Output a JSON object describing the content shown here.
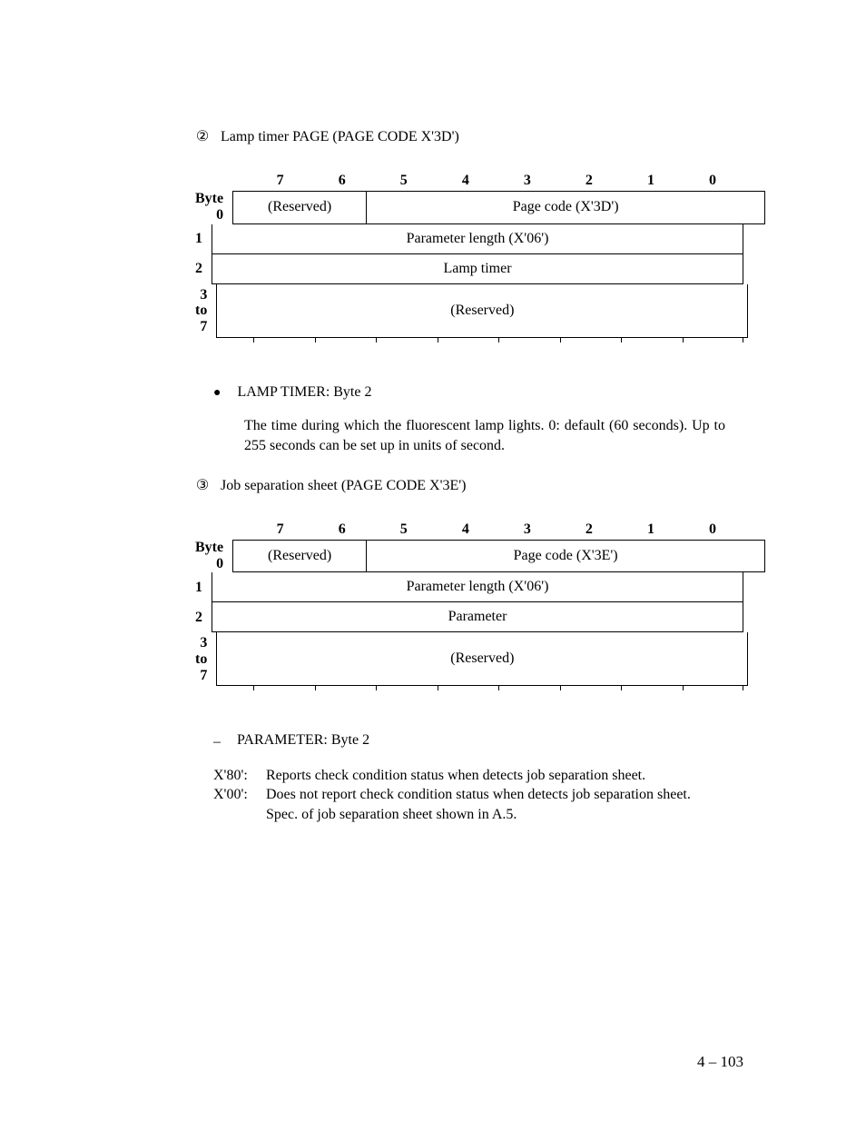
{
  "section1": {
    "num_glyph": "②",
    "title": "Lamp timer PAGE (PAGE CODE X'3D')"
  },
  "bits": [
    "7",
    "6",
    "5",
    "4",
    "3",
    "2",
    "1",
    "0"
  ],
  "table1": {
    "rows": [
      {
        "label": "Byte 0",
        "cells": [
          {
            "span": 2,
            "text": "(Reserved)"
          },
          {
            "span": 6,
            "text": "Page code (X'3D')"
          }
        ]
      },
      {
        "label": "1",
        "cells": [
          {
            "span": 8,
            "text": "Parameter length (X'06')"
          }
        ]
      },
      {
        "label": "2",
        "cells": [
          {
            "span": 8,
            "text": "Lamp timer"
          }
        ]
      },
      {
        "label_multi": [
          "3",
          "to",
          "7"
        ],
        "tall": true,
        "cells": [
          {
            "span": 8,
            "text": "(Reserved)"
          }
        ]
      }
    ]
  },
  "bullet1": {
    "mark": "●",
    "heading": "LAMP TIMER:  Byte 2",
    "body": "The time during which the fluorescent lamp lights.  0:  default (60 seconds). Up to 255 seconds can be set up in units of second."
  },
  "section2": {
    "num_glyph": "③",
    "title": "Job separation sheet (PAGE CODE X'3E')"
  },
  "table2": {
    "rows": [
      {
        "label": "Byte 0",
        "cells": [
          {
            "span": 2,
            "text": "(Reserved)"
          },
          {
            "span": 6,
            "text": "Page code (X'3E')"
          }
        ]
      },
      {
        "label": "1",
        "cells": [
          {
            "span": 8,
            "text": "Parameter length (X'06')"
          }
        ]
      },
      {
        "label": "2",
        "cells": [
          {
            "span": 8,
            "text": "Parameter"
          }
        ]
      },
      {
        "label_multi": [
          "3",
          "to",
          "7"
        ],
        "tall": true,
        "cells": [
          {
            "span": 8,
            "text": "(Reserved)"
          }
        ]
      }
    ]
  },
  "dash1": {
    "mark": "–",
    "heading": "PARAMETER:  Byte 2"
  },
  "codes": [
    {
      "key": "X'80':",
      "val": "Reports check condition status when detects job separation sheet."
    },
    {
      "key": "X'00':",
      "val": "Does not report check condition status when detects job separation sheet."
    }
  ],
  "code_note": "Spec. of job separation sheet shown in A.5.",
  "page_number": "4 – 103"
}
